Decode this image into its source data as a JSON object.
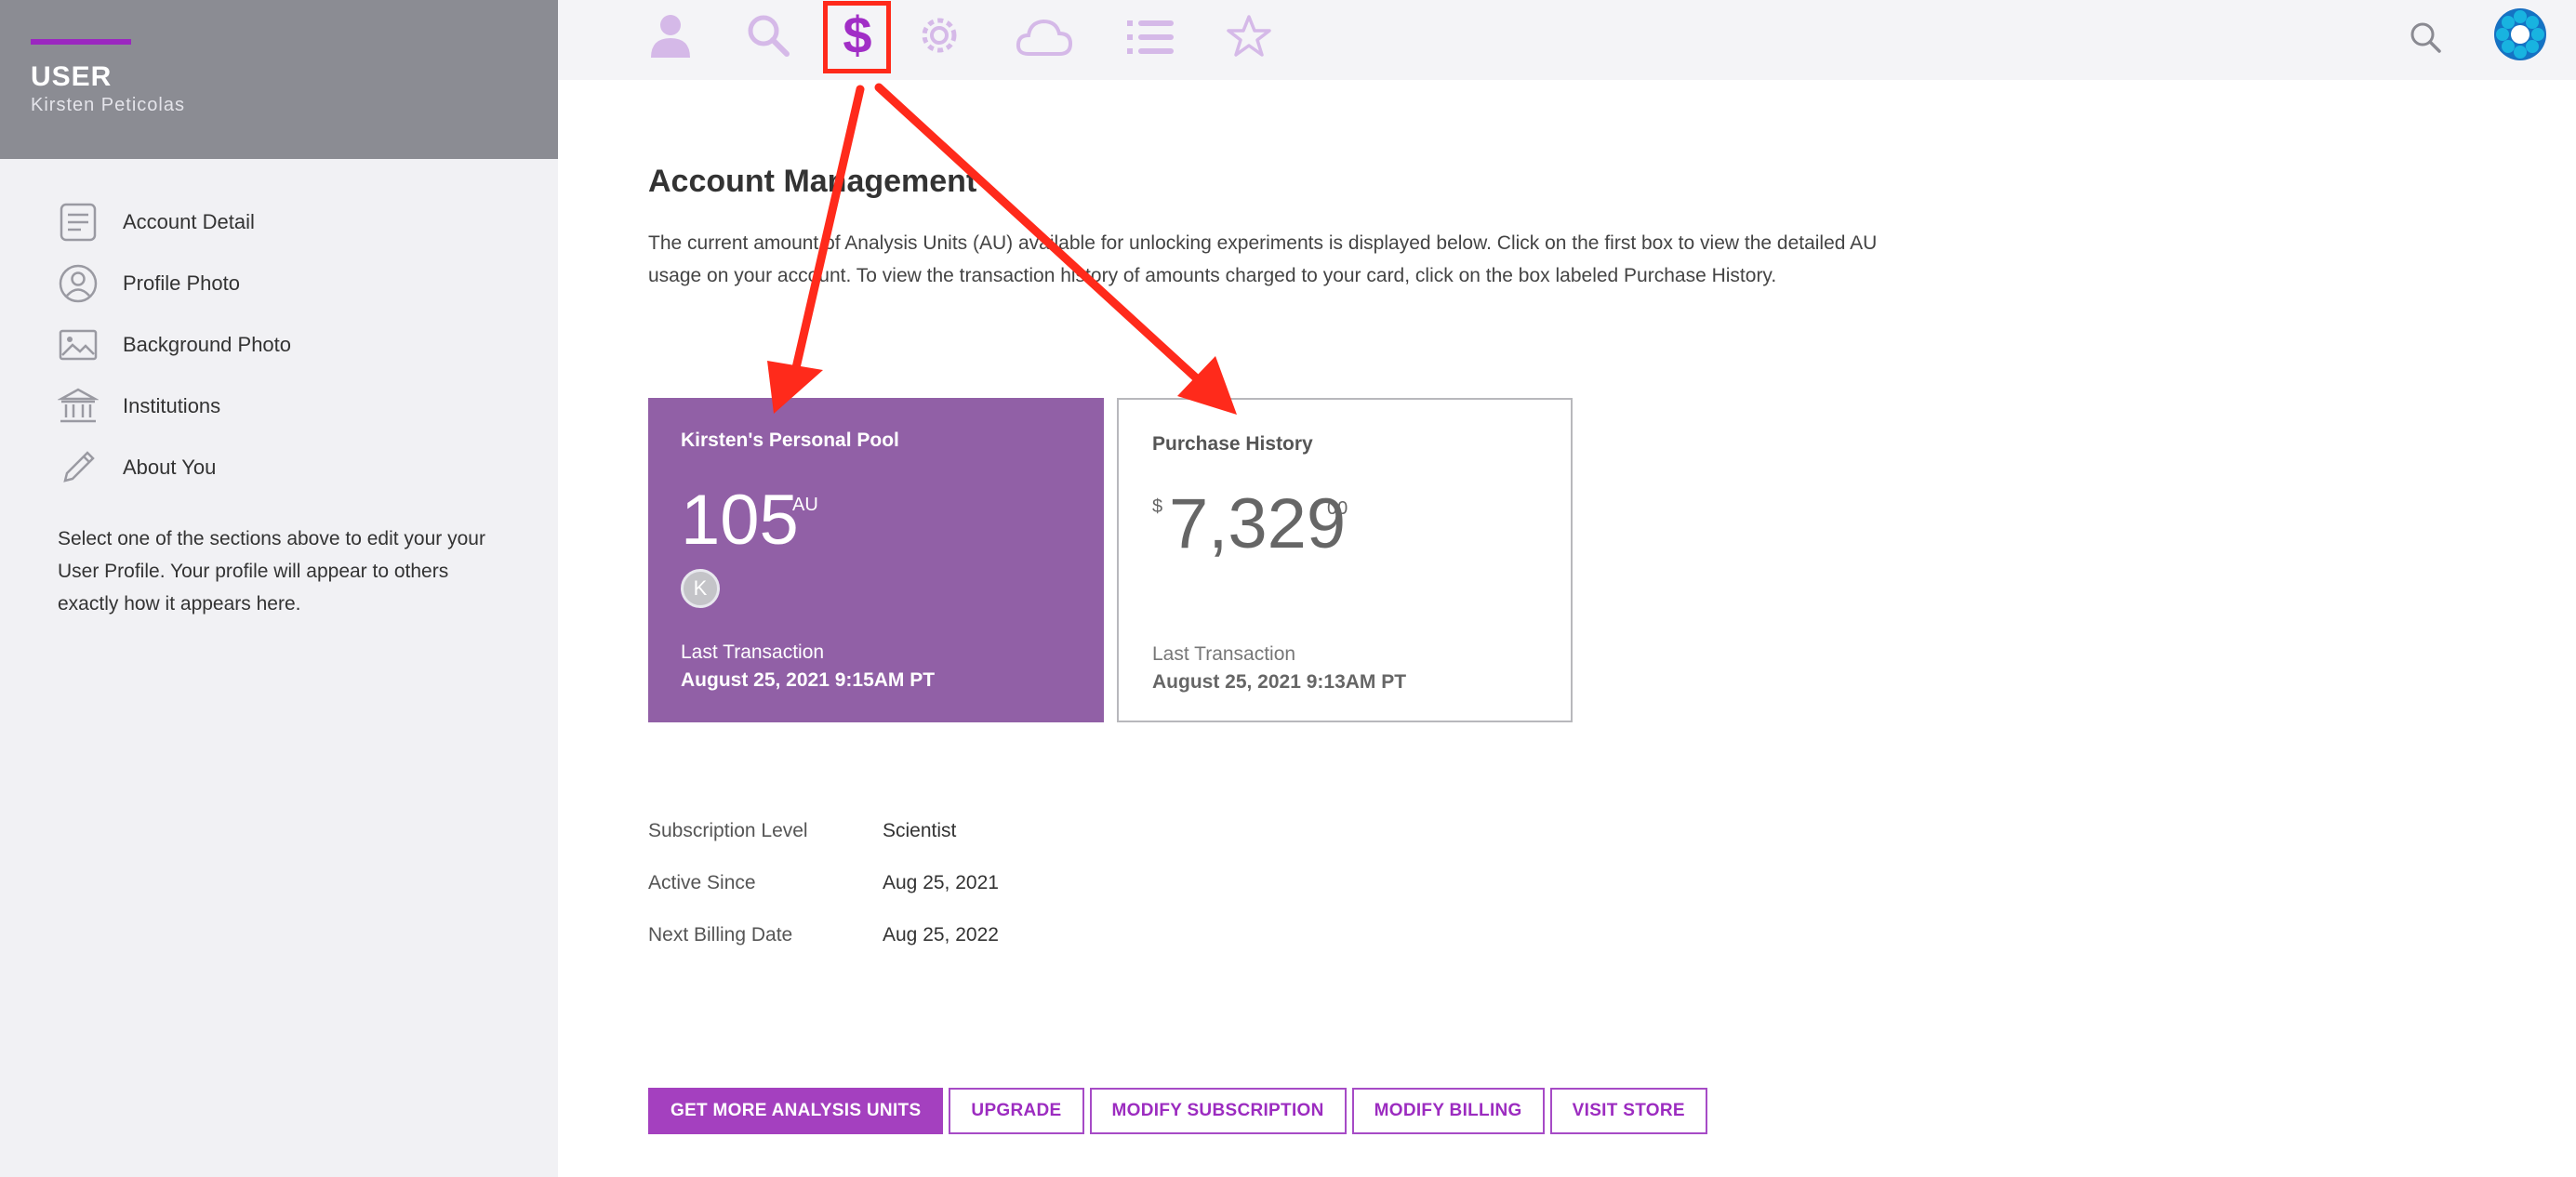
{
  "sidebar": {
    "role": "USER",
    "user_name": "Kirsten Peticolas",
    "items": [
      {
        "label": "Account Detail",
        "icon": "document-icon"
      },
      {
        "label": "Profile Photo",
        "icon": "profile-circle-icon"
      },
      {
        "label": "Background Photo",
        "icon": "image-icon"
      },
      {
        "label": "Institutions",
        "icon": "institution-icon"
      },
      {
        "label": "About You",
        "icon": "pencil-icon"
      }
    ],
    "note": "Select one of the sections above to edit your your User Profile. Your profile will appear to others exactly how it appears here."
  },
  "topbar": {
    "icons": [
      "user-icon",
      "search-icon",
      "dollar-icon",
      "gear-icon",
      "cloud-icon",
      "list-icon",
      "star-icon"
    ],
    "active": "dollar-icon",
    "right_icons": [
      "search-icon",
      "brand-logo-icon"
    ]
  },
  "main": {
    "title": "Account Management",
    "intro": "The current amount of Analysis Units (AU) available for unlocking experiments is displayed below. Click on the first box to view the detailed AU usage on your account. To view the transaction history of amounts charged to your card, click on the box labeled Purchase History.",
    "pool_card": {
      "title": "Kirsten's Personal Pool",
      "value": "105",
      "unit": "AU",
      "avatar_initial": "K",
      "last_label": "Last Transaction",
      "last_date": "August 25, 2021 9:15AM PT"
    },
    "purchase_card": {
      "title": "Purchase History",
      "currency": "$",
      "amount": "7,329",
      "cents": "00",
      "last_label": "Last Transaction",
      "last_date": "August 25, 2021 9:13AM PT"
    },
    "subscription": [
      {
        "label": "Subscription Level",
        "value": "Scientist"
      },
      {
        "label": "Active Since",
        "value": "Aug 25, 2021"
      },
      {
        "label": "Next Billing Date",
        "value": "Aug 25, 2022"
      }
    ],
    "buttons": [
      "GET MORE ANALYSIS UNITS",
      "UPGRADE",
      "MODIFY SUBSCRIPTION",
      "MODIFY BILLING",
      "VISIT STORE"
    ]
  },
  "colors": {
    "accent_purple": "#9b27c0",
    "card_purple": "#9160a6",
    "icon_lavender": "#d5b9e8",
    "annotation_red": "#ff2a1b"
  }
}
